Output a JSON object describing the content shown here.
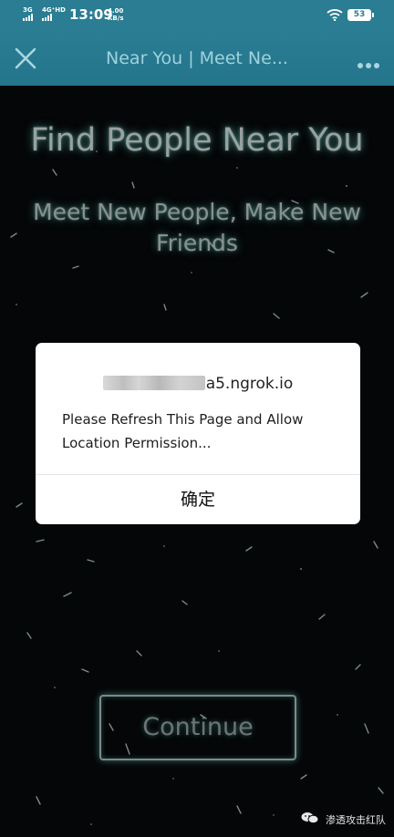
{
  "status_bar": {
    "network_1": "3G",
    "network_2": "4G⁺HD",
    "time": "13:09",
    "speed_value": "4.00",
    "speed_unit": "KB/s",
    "battery": "53"
  },
  "app_bar": {
    "title": "Near You | Meet Ne...",
    "close_icon": "close-icon",
    "more_icon": "more-icon"
  },
  "page": {
    "headline": "Find People Near You",
    "subhead": "Meet New People, Make New Friends",
    "continue_label": "Continue"
  },
  "dialog": {
    "host_visible": "a5.ngrok.io",
    "message": "Please Refresh This Page and Allow Location Permission...",
    "ok_label": "确定"
  },
  "watermark": {
    "text": "渗透攻击红队"
  },
  "colors": {
    "accent": "#2a7d93",
    "background": "#040607",
    "glow": "#78e6dc"
  }
}
